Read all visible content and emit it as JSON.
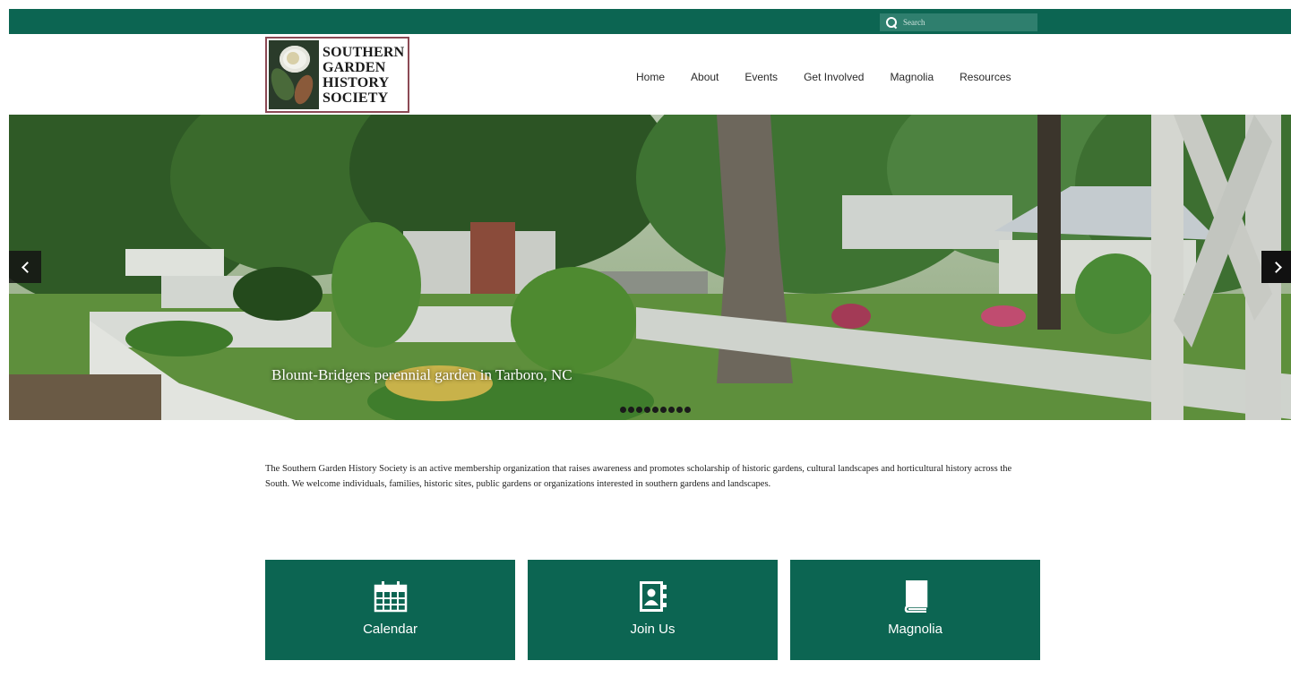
{
  "colors": {
    "brand_green": "#0c6552",
    "search_bg": "#2f7f6e",
    "logo_border": "#8c4a55"
  },
  "search": {
    "placeholder": "Search"
  },
  "logo": {
    "lines": [
      "SOUTHERN",
      "GARDEN",
      "HISTORY",
      "SOCIETY"
    ]
  },
  "nav": {
    "items": [
      {
        "label": "Home"
      },
      {
        "label": "About"
      },
      {
        "label": "Events"
      },
      {
        "label": "Get Involved"
      },
      {
        "label": "Magnolia"
      },
      {
        "label": "Resources"
      }
    ]
  },
  "hero": {
    "caption": "Blount-Bridgers perennial garden in Tarboro, NC",
    "prev_icon": "chevron-left-icon",
    "next_icon": "chevron-right-icon",
    "dot_count": 9
  },
  "intro": {
    "text": "The Southern Garden History Society is an active membership organization that raises awareness and promotes scholarship of historic gardens, cultural landscapes and horticultural history across the South. We welcome individuals, families, historic sites, public gardens or organizations interested in southern gardens and landscapes."
  },
  "tiles": [
    {
      "label": "Calendar",
      "icon": "calendar-icon"
    },
    {
      "label": "Join Us",
      "icon": "address-book-icon"
    },
    {
      "label": "Magnolia",
      "icon": "book-icon"
    }
  ]
}
